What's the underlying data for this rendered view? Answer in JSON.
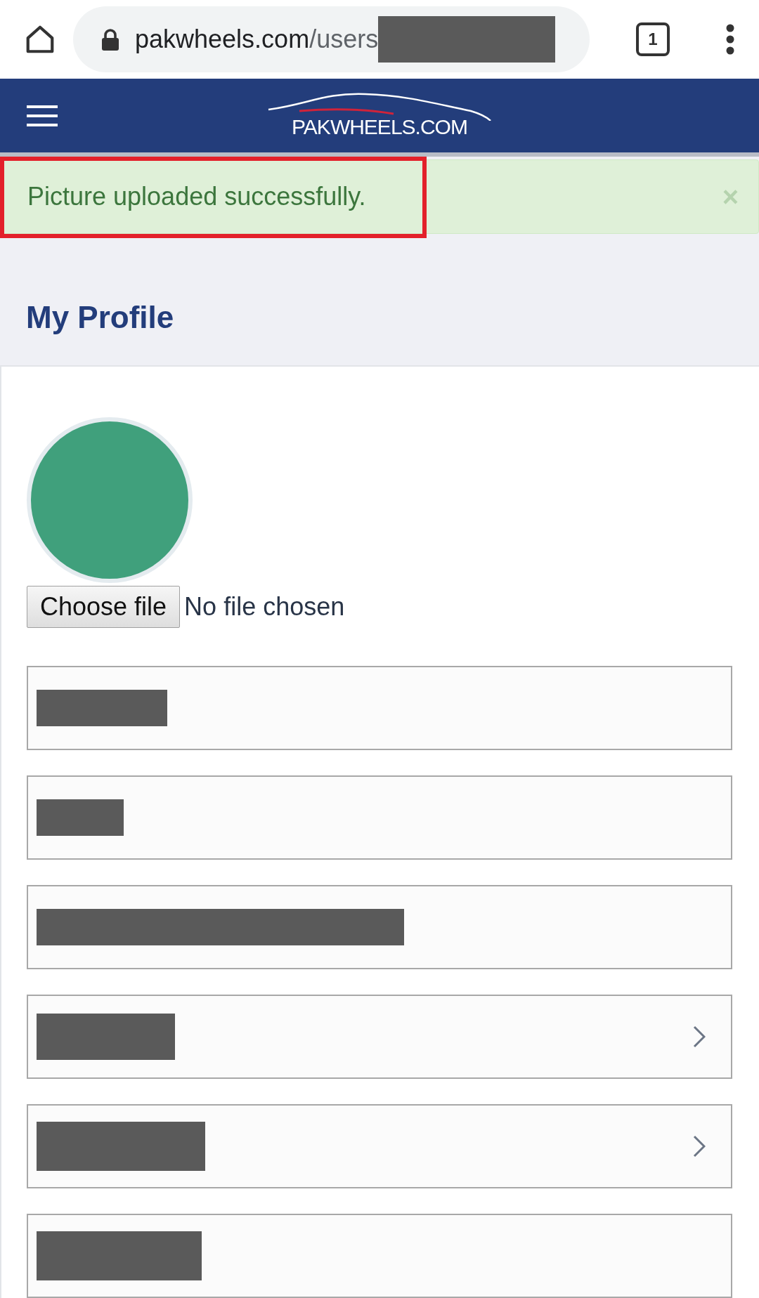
{
  "browser": {
    "url_host": "pakwheels.com",
    "url_path": "/users",
    "tab_count": "1"
  },
  "header": {
    "logo": "PAKWHEELS.COM"
  },
  "alert": {
    "message": "Picture uploaded successfully.",
    "close": "×",
    "highlighted": true
  },
  "page_title": "My Profile",
  "avatar": {
    "color": "#40a07c"
  },
  "file_input": {
    "button": "Choose file",
    "status": "No file chosen"
  },
  "fields": [
    {
      "kind": "text"
    },
    {
      "kind": "text"
    },
    {
      "kind": "text"
    },
    {
      "kind": "select"
    },
    {
      "kind": "select"
    },
    {
      "kind": "text"
    }
  ]
}
